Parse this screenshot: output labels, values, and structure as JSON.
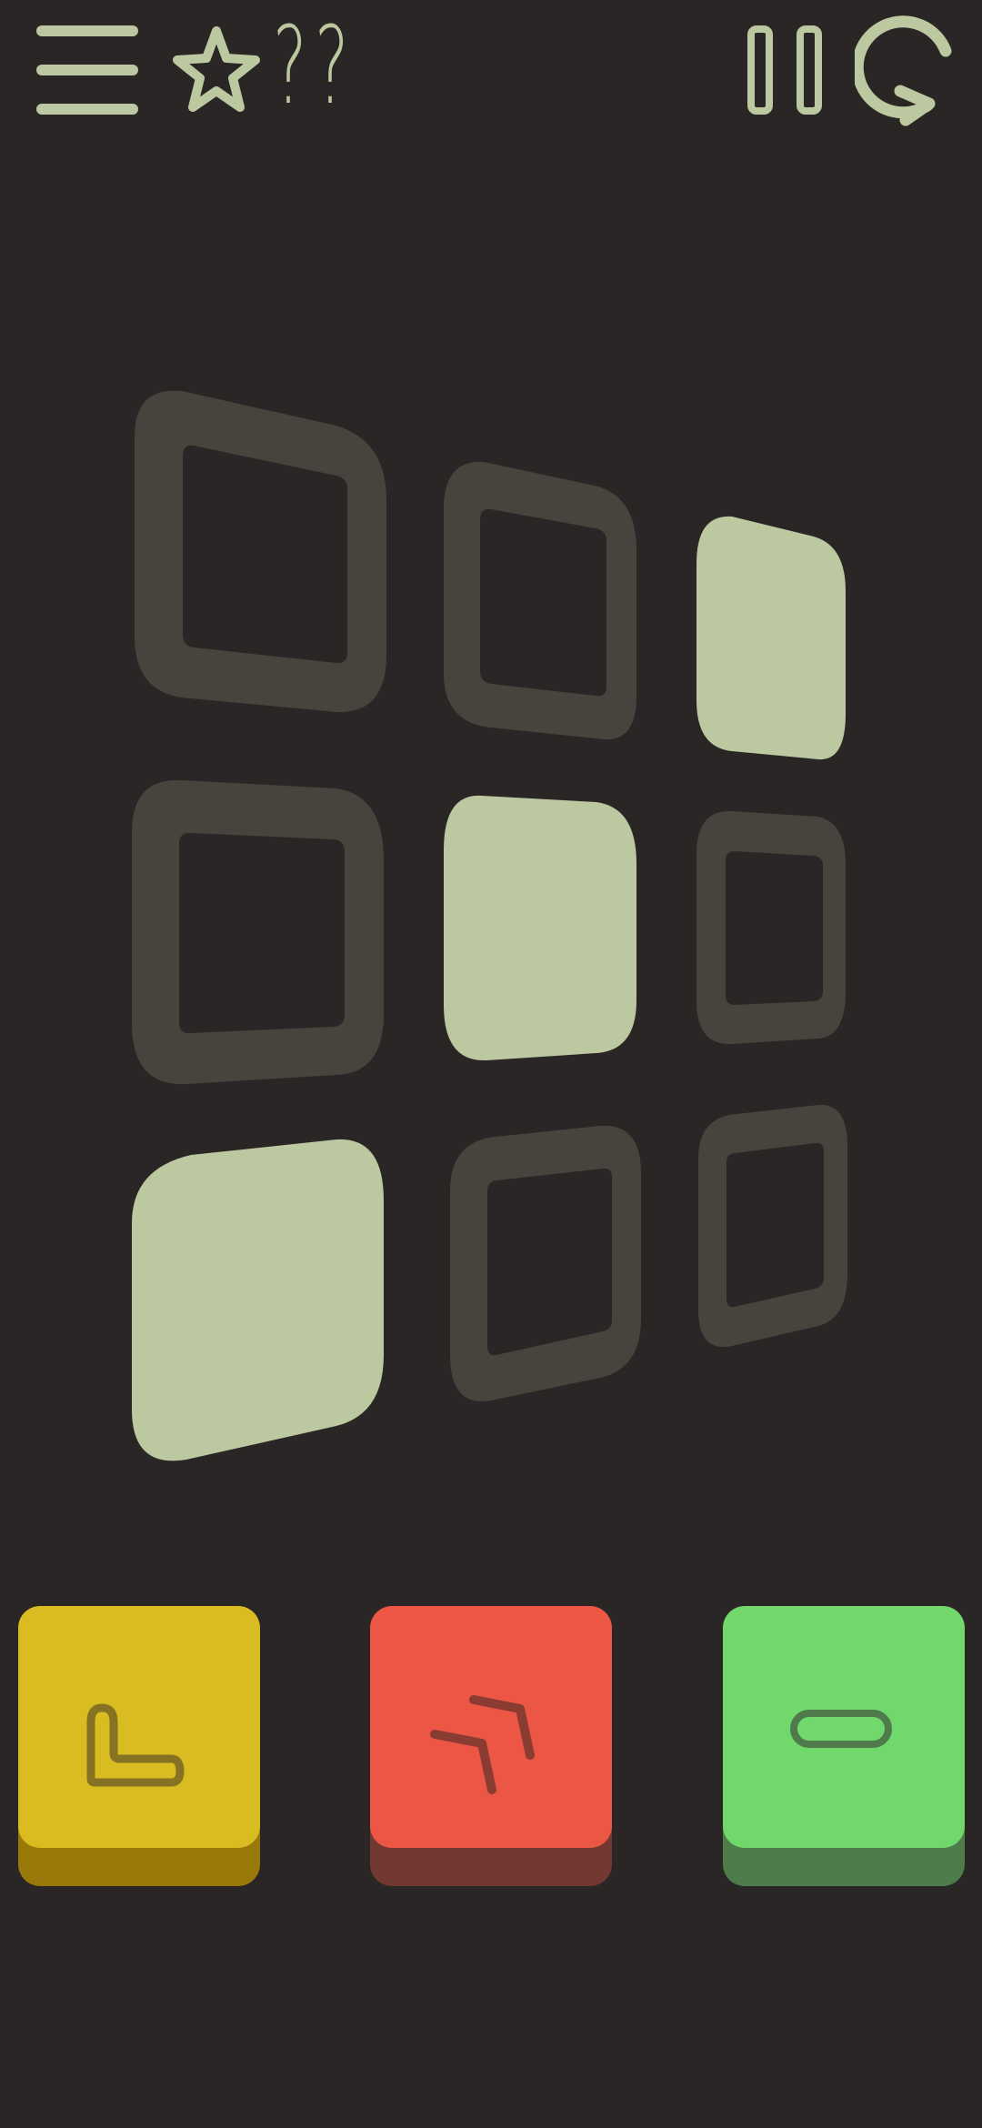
{
  "header": {
    "menu_icon": "hamburger-menu-icon",
    "star_icon": "star-outline-icon",
    "stars_value": "??",
    "pause_icon": "pause-icon",
    "restart_icon": "restart-arrow-icon"
  },
  "colors": {
    "background": "#2b2626",
    "ui_accent": "#bcc89f",
    "tile_empty": "#48433d",
    "tile_filled": "#bcc89f",
    "move_l": "#d9bb22",
    "move_l_shadow": "#98790a",
    "move_diag": "#eb5744",
    "move_diag_shadow": "#743832",
    "move_line": "#71d86c",
    "move_line_shadow": "#4e7d4b"
  },
  "board": {
    "rows": 3,
    "cols": 3,
    "tiles": [
      [
        "empty",
        "empty",
        "filled"
      ],
      [
        "empty",
        "filled",
        "empty"
      ],
      [
        "filled",
        "empty",
        "empty"
      ]
    ]
  },
  "moves": [
    {
      "name": "move-l-button",
      "icon": "l-shape-icon",
      "color_key": "move_l"
    },
    {
      "name": "move-diagonal-button",
      "icon": "double-chevron-icon",
      "color_key": "move_diag"
    },
    {
      "name": "move-line-button",
      "icon": "horizontal-bar-icon",
      "color_key": "move_line"
    }
  ]
}
